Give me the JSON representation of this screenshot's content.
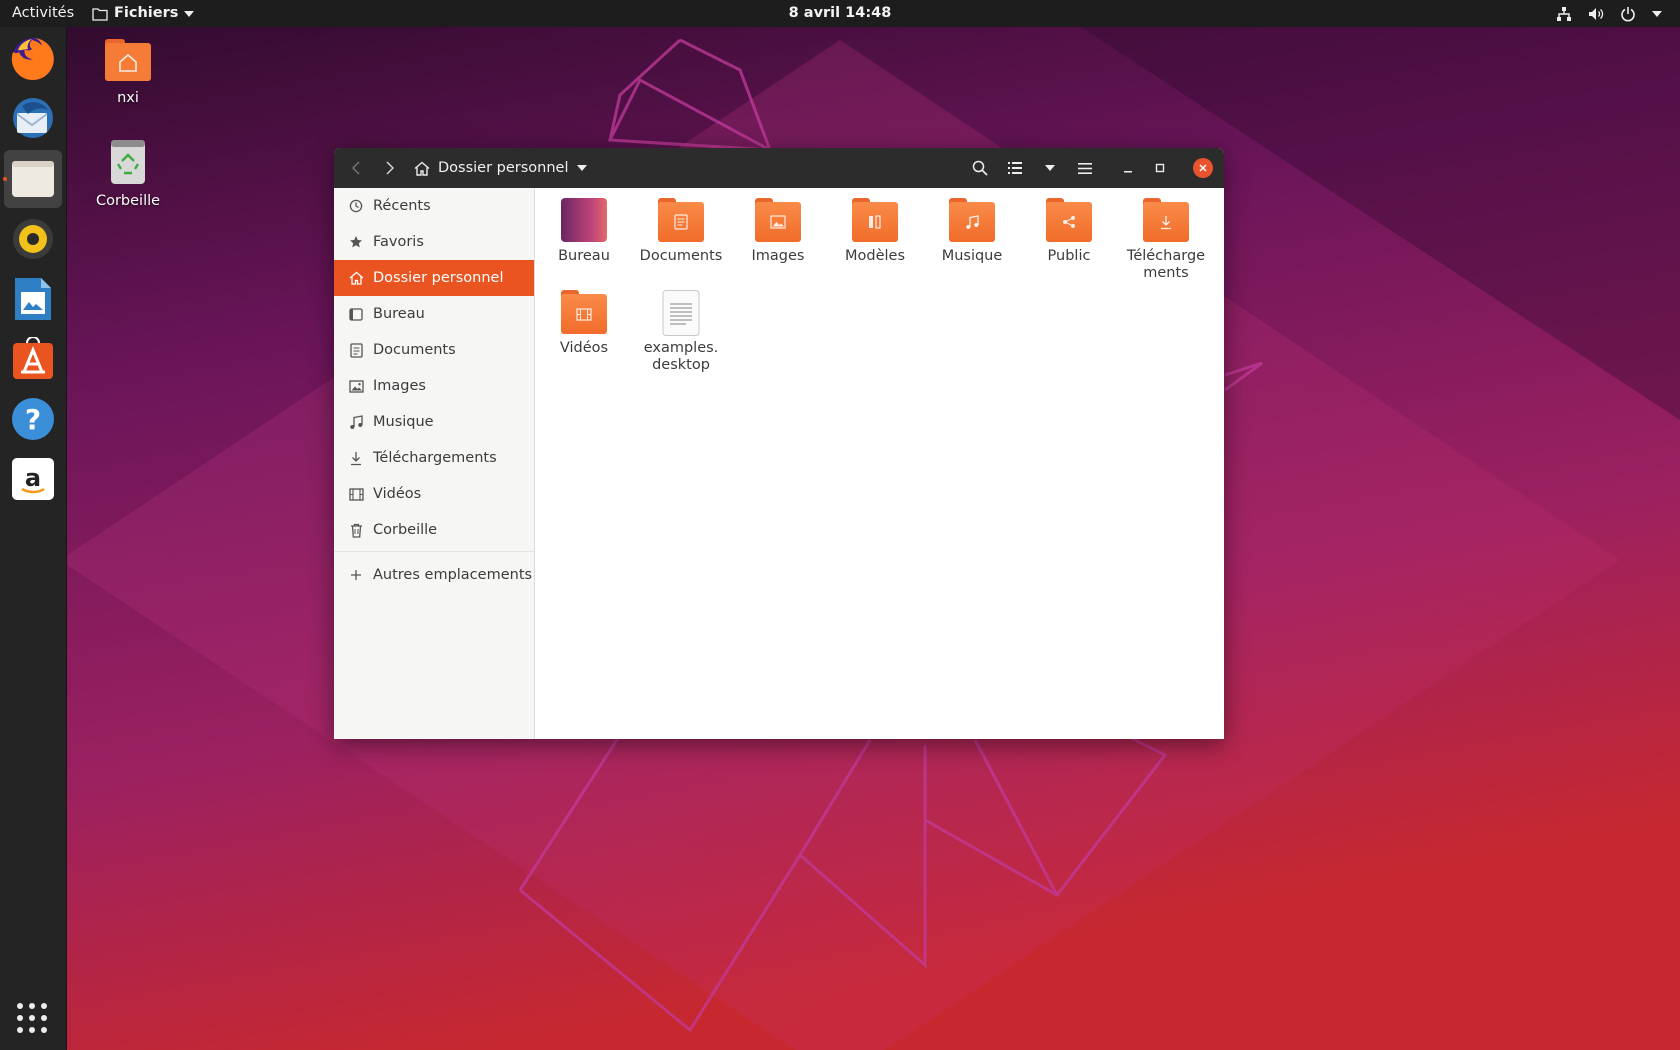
{
  "topbar": {
    "activities": "Activités",
    "app_menu": "Fichiers",
    "clock": "8 avril  14:48",
    "tray_icons": [
      "network-icon",
      "volume-icon",
      "power-icon"
    ]
  },
  "dock": {
    "apps": [
      "Firefox",
      "Thunderbird",
      "Fichiers",
      "Rhythmbox",
      "LibreOffice Writer",
      "Ubuntu Software",
      "Aide",
      "Amazon"
    ],
    "active": "Fichiers"
  },
  "desktop": {
    "icons": [
      {
        "label": "nxi"
      },
      {
        "label": "Corbeille"
      }
    ]
  },
  "window": {
    "location": "Dossier personnel",
    "sidebar": {
      "items": [
        {
          "label": "Récents",
          "icon": "clock-icon"
        },
        {
          "label": "Favoris",
          "icon": "star-icon"
        },
        {
          "label": "Dossier personnel",
          "icon": "home-icon",
          "selected": true
        },
        {
          "label": "Bureau",
          "icon": "desktop-icon"
        },
        {
          "label": "Documents",
          "icon": "document-icon"
        },
        {
          "label": "Images",
          "icon": "image-icon"
        },
        {
          "label": "Musique",
          "icon": "music-icon"
        },
        {
          "label": "Téléchargements",
          "icon": "download-icon"
        },
        {
          "label": "Vidéos",
          "icon": "film-icon"
        },
        {
          "label": "Corbeille",
          "icon": "trash-icon"
        }
      ],
      "other_locations": "Autres emplacements"
    },
    "files": [
      {
        "name": "Bureau",
        "kind": "desktop-folder"
      },
      {
        "name": "Documents",
        "kind": "documents-folder"
      },
      {
        "name": "Images",
        "kind": "pictures-folder"
      },
      {
        "name": "Modèles",
        "kind": "templates-folder"
      },
      {
        "name": "Musique",
        "kind": "music-folder"
      },
      {
        "name": "Public",
        "kind": "public-folder"
      },
      {
        "name_line1": "Télécharge",
        "name_line2": "ments",
        "kind": "downloads-folder"
      },
      {
        "name": "Vidéos",
        "kind": "videos-folder"
      },
      {
        "name_line1": "examples.",
        "name_line2": "desktop",
        "kind": "text-file"
      }
    ]
  },
  "colors": {
    "accent": "#e95420",
    "topbar": "#1d1d1d",
    "dock": "#242424",
    "headerbar": "#2c2c2c"
  }
}
